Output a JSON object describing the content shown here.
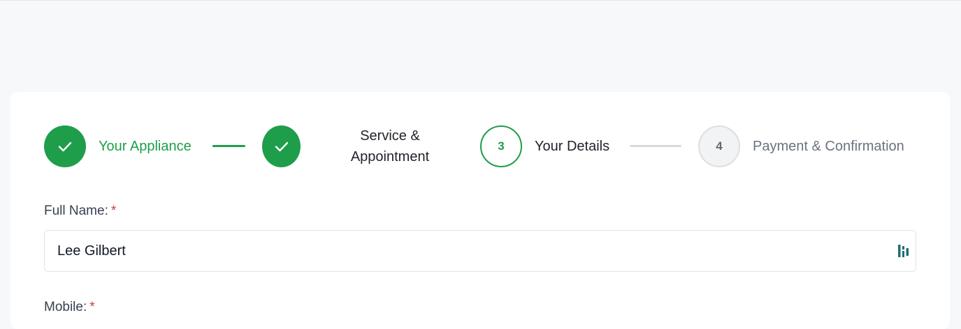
{
  "stepper": {
    "steps": [
      {
        "number": "1",
        "label": "Your Appliance",
        "state": "done",
        "icon": "check-icon"
      },
      {
        "number": "2",
        "label_line1": "Service &",
        "label_line2": "Appointment",
        "state": "done",
        "icon": "check-icon"
      },
      {
        "number": "3",
        "label": "Your Details",
        "state": "current"
      },
      {
        "number": "4",
        "label": "Payment & Confirmation",
        "state": "pending"
      }
    ]
  },
  "form": {
    "full_name": {
      "label": "Full Name:",
      "required_mark": "*",
      "value": "Lee Gilbert",
      "icon": "autofill-icon"
    },
    "mobile": {
      "label": "Mobile:",
      "required_mark": "*"
    }
  },
  "colors": {
    "accent": "#1e9e4a",
    "required": "#d33a3a",
    "pending": "#6b7280"
  }
}
